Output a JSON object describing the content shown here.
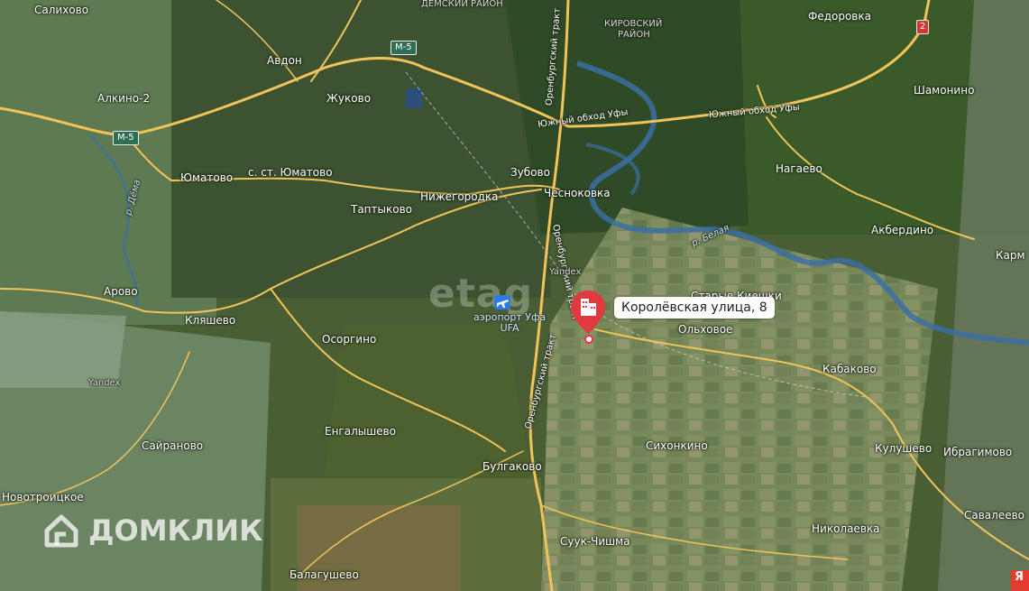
{
  "map": {
    "place_labels": [
      {
        "id": "salikhovo",
        "text": "Салихово"
      },
      {
        "id": "avdon",
        "text": "Авдон"
      },
      {
        "id": "alkino2",
        "text": "Алкино-2"
      },
      {
        "id": "zhukovo",
        "text": "Жуково"
      },
      {
        "id": "yumatovo",
        "text": "Юматово"
      },
      {
        "id": "st-yumatovo",
        "text": "с. ст. Юматово"
      },
      {
        "id": "zubovo",
        "text": "Зубово"
      },
      {
        "id": "nizhegorodka",
        "text": "Нижегородка"
      },
      {
        "id": "chesnokovka",
        "text": "Чесноковка"
      },
      {
        "id": "taptykovo",
        "text": "Таптыково"
      },
      {
        "id": "fedorovka",
        "text": "Федоровка"
      },
      {
        "id": "shamonino",
        "text": "Шамонино"
      },
      {
        "id": "nagaevo",
        "text": "Нагаево"
      },
      {
        "id": "akberdino",
        "text": "Акбердино"
      },
      {
        "id": "karm",
        "text": "Карм"
      },
      {
        "id": "arovo",
        "text": "Арово"
      },
      {
        "id": "klyashevo",
        "text": "Кляшево"
      },
      {
        "id": "osorgino",
        "text": "Осоргино"
      },
      {
        "id": "starye-kiyshki",
        "text": "Старые Киешки"
      },
      {
        "id": "olkhovoe",
        "text": "Ольховое"
      },
      {
        "id": "kabakovo",
        "text": "Кабаково"
      },
      {
        "id": "engalyshevo",
        "text": "Енгалышево"
      },
      {
        "id": "sairanovo",
        "text": "Сайраново"
      },
      {
        "id": "sikhonkino",
        "text": "Сихонкино"
      },
      {
        "id": "kulushevo",
        "text": "Кулушево"
      },
      {
        "id": "ibragimovo",
        "text": "Ибрагимово"
      },
      {
        "id": "bulgakovo",
        "text": "Булгаково"
      },
      {
        "id": "novotroitskoe",
        "text": "Новотроицкое"
      },
      {
        "id": "savaleevo",
        "text": "Савалеево"
      },
      {
        "id": "nikolaevka",
        "text": "Николаевка"
      },
      {
        "id": "suuk-chishma",
        "text": "Суук-Чишма"
      },
      {
        "id": "balagushevo",
        "text": "Балагушево"
      }
    ],
    "district_labels": {
      "demsky": "ДЕМСКИЙ РАЙОН",
      "kirovsky_1": "КИРОВСКИЙ",
      "kirovsky_2": "РАЙОН"
    },
    "road_labels": {
      "south_bypass_1": "Южный обход Уфы",
      "south_bypass_2": "Южный обход Уфы",
      "orenburg_tract_1": "Оренбургский тракт",
      "orenburg_tract_2": "Оренбургский тракт",
      "orenburg_tract_3": "Оренбургский тракт"
    },
    "route_shields": {
      "m5_north": "M-5",
      "m5_west": "M-5",
      "r_east": "2"
    },
    "rivers": {
      "dema": "р. Дёма",
      "belaya": "р. Белая"
    },
    "airport": {
      "line1": "аэропорт Уфа",
      "line2": "UFA"
    },
    "imagery_watermarks": {
      "yandex_1": "Yandex",
      "yandex_2": "Yandex"
    },
    "marker": {
      "address": "Королёвская улица, 8",
      "pin_icon": "building-pin-icon",
      "pin_color": "#e0393e"
    }
  },
  "branding": {
    "watermark": "etag",
    "logo_icon": "domclick-logo-icon",
    "logo_text": "ДОМКЛИК",
    "corner_badge": "Я"
  },
  "colors": {
    "road": "#f0c45a",
    "river": "#3b6ea3",
    "marker": "#e0393e"
  }
}
